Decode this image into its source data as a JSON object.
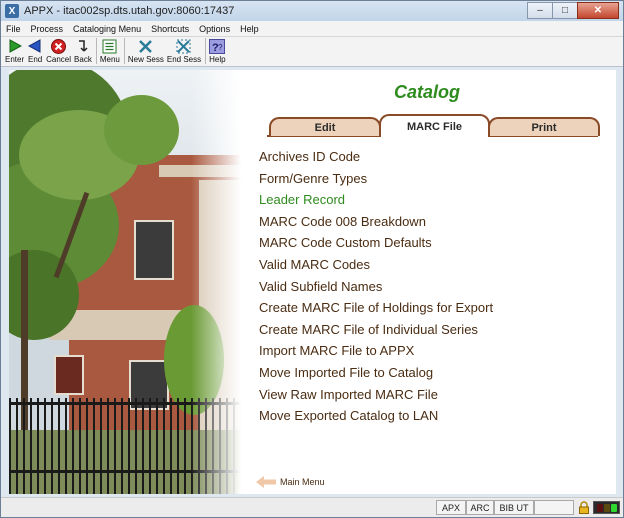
{
  "window": {
    "title": "APPX - itac002sp.dts.utah.gov:8060:17437",
    "buttons": {
      "minimize": "–",
      "maximize": "□",
      "close": "✕"
    }
  },
  "menubar": {
    "items": [
      "File",
      "Process",
      "Cataloging Menu",
      "Shortcuts",
      "Options",
      "Help"
    ]
  },
  "toolbar": {
    "buttons": [
      {
        "label": "Enter",
        "icon": "enter-arrow-icon"
      },
      {
        "label": "End",
        "icon": "end-arrow-icon"
      },
      {
        "label": "Cancel",
        "icon": "cancel-icon"
      },
      {
        "label": "Back",
        "icon": "back-icon"
      },
      {
        "label": "Menu",
        "icon": "menu-icon"
      },
      {
        "label": "New Sess",
        "icon": "new-session-icon"
      },
      {
        "label": "End Sess",
        "icon": "end-session-icon"
      },
      {
        "label": "Help",
        "icon": "help-icon"
      }
    ]
  },
  "page": {
    "title": "Catalog",
    "tabs": [
      {
        "label": "Edit",
        "active": false
      },
      {
        "label": "MARC File",
        "active": true
      },
      {
        "label": "Print",
        "active": false
      }
    ],
    "menu_items": [
      "Archives ID Code",
      "Form/Genre Types",
      "Leader Record",
      "MARC Code 008 Breakdown",
      "MARC Code Custom Defaults",
      "Valid MARC Codes",
      "Valid Subfield Names",
      "Create MARC File of Holdings for Export",
      "Create MARC File of Individual Series",
      "Import MARC File to APPX",
      "Move Imported File to Catalog",
      "View Raw Imported MARC File",
      "Move Exported Catalog to LAN"
    ],
    "highlighted_item": "Leader Record",
    "main_menu_label": "Main Menu"
  },
  "statusbar": {
    "cells": [
      "APX",
      "ARC",
      "BIB UT"
    ]
  },
  "colors": {
    "title_green": "#2e8b1e",
    "link_brown": "#4a2c12",
    "tab_border": "#8a4a26",
    "tab_fill": "#edd3bb"
  }
}
